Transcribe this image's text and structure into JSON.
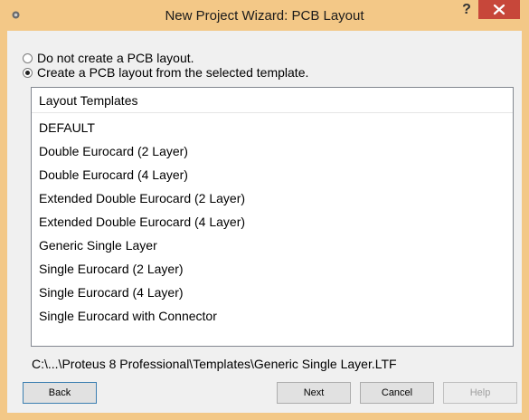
{
  "window": {
    "title": "New Project Wizard: PCB Layout",
    "help_label": "?"
  },
  "options": {
    "no_layout": "Do not create a PCB layout.",
    "from_template": "Create a PCB layout from the selected template.",
    "selected": "from_template"
  },
  "templates": {
    "header": "Layout Templates",
    "items": [
      "DEFAULT",
      "Double Eurocard (2 Layer)",
      "Double Eurocard (4 Layer)",
      "Extended Double Eurocard (2 Layer)",
      "Extended Double Eurocard (4 Layer)",
      "Generic Single Layer",
      "Single Eurocard (2 Layer)",
      "Single Eurocard (4 Layer)",
      "Single Eurocard with Connector"
    ]
  },
  "path": "C:\\...\\Proteus 8 Professional\\Templates\\Generic Single Layer.LTF",
  "buttons": {
    "back": "Back",
    "next": "Next",
    "cancel": "Cancel",
    "help": "Help"
  },
  "colors": {
    "frame": "#f3c887",
    "close": "#c7473a",
    "client": "#f0f0f0"
  }
}
